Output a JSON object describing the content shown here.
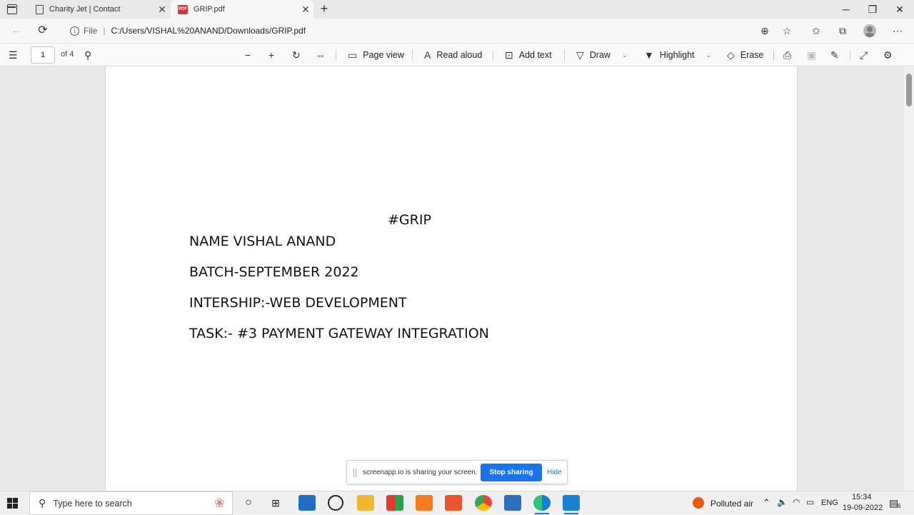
{
  "browser": {
    "tabs": [
      {
        "title": "Charity Jet | Contact",
        "active": false
      },
      {
        "title": "GRIP.pdf",
        "active": true
      }
    ],
    "address": {
      "scheme_label": "File",
      "url": "C:/Users/VISHAL%20ANAND/Downloads/GRIP.pdf"
    }
  },
  "pdf_toolbar": {
    "page_number": "1",
    "page_of": "of 4",
    "page_view": "Page view",
    "read_aloud": "Read aloud",
    "add_text": "Add text",
    "draw": "Draw",
    "highlight": "Highlight",
    "erase": "Erase"
  },
  "document": {
    "heading": "#GRIP",
    "lines": [
      "NAME  VISHAL ANAND",
      "BATCH-SEPTEMBER 2022",
      "INTERSHIP:-WEB DEVELOPMENT",
      "TASK:- #3 PAYMENT GATEWAY INTEGRATION"
    ]
  },
  "share_bar": {
    "message": "screenapp.io is sharing your screen.",
    "stop_label": "Stop sharing",
    "hide_label": "Hide"
  },
  "taskbar": {
    "search_placeholder": "Type here to search",
    "weather": "Polluted air",
    "language": "ENG",
    "time": "15:34",
    "date": "19-09-2022",
    "notification_count": "6"
  },
  "colors": {
    "accent": "#1a73e8",
    "pdf_badge": "#d13438",
    "weather_icon": "#e8590c"
  }
}
